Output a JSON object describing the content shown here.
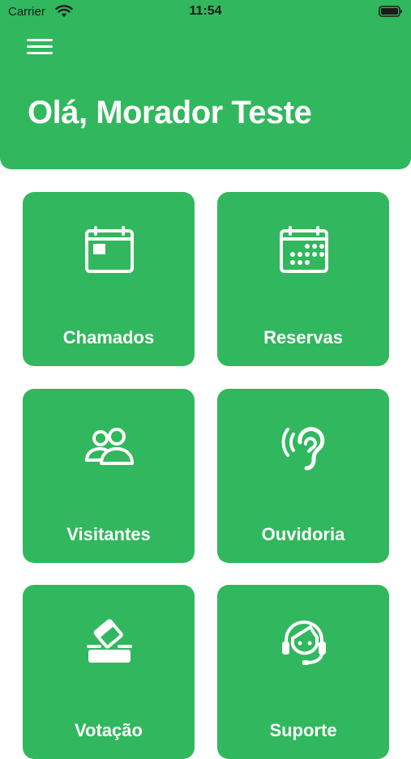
{
  "status_bar": {
    "carrier": "Carrier",
    "time": "11:54"
  },
  "header": {
    "greeting": "Olá, Morador Teste",
    "menu_icon": "hamburger-menu-icon"
  },
  "colors": {
    "brand_green": "#31b75d",
    "text_on_brand": "#ffffff",
    "background": "#ffffff"
  },
  "tiles": [
    {
      "label": "Chamados",
      "icon": "ticket-calendar-icon"
    },
    {
      "label": "Reservas",
      "icon": "calendar-icon"
    },
    {
      "label": "Visitantes",
      "icon": "visitors-icon"
    },
    {
      "label": "Ouvidoria",
      "icon": "ear-icon"
    },
    {
      "label": "Votação",
      "icon": "ballot-box-icon"
    },
    {
      "label": "Suporte",
      "icon": "headset-support-icon"
    }
  ]
}
